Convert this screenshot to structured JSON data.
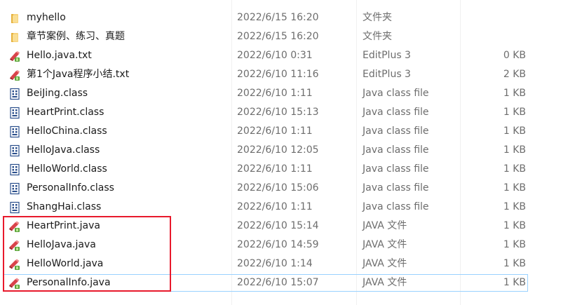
{
  "files": [
    {
      "name": "myhello",
      "date": "2022/6/15 16:20",
      "type": "文件夹",
      "size": "",
      "icon": "folder-icon"
    },
    {
      "name": "章节案例、练习、真题",
      "date": "2022/6/15 16:20",
      "type": "文件夹",
      "size": "",
      "icon": "folder-icon"
    },
    {
      "name": "Hello.java.txt",
      "date": "2022/6/10 0:31",
      "type": "EditPlus 3",
      "size": "0 KB",
      "icon": "editplus-file-icon"
    },
    {
      "name": "第1个Java程序小结.txt",
      "date": "2022/6/10 11:16",
      "type": "EditPlus 3",
      "size": "2 KB",
      "icon": "editplus-file-icon"
    },
    {
      "name": "BeiJing.class",
      "date": "2022/6/10 1:11",
      "type": "Java class file",
      "size": "1 KB",
      "icon": "class-file-icon"
    },
    {
      "name": "HeartPrint.class",
      "date": "2022/6/10 15:13",
      "type": "Java class file",
      "size": "1 KB",
      "icon": "class-file-icon"
    },
    {
      "name": "HelloChina.class",
      "date": "2022/6/10 1:11",
      "type": "Java class file",
      "size": "1 KB",
      "icon": "class-file-icon"
    },
    {
      "name": "HelloJava.class",
      "date": "2022/6/10 12:05",
      "type": "Java class file",
      "size": "1 KB",
      "icon": "class-file-icon"
    },
    {
      "name": "HelloWorld.class",
      "date": "2022/6/10 1:11",
      "type": "Java class file",
      "size": "1 KB",
      "icon": "class-file-icon"
    },
    {
      "name": "PersonalInfo.class",
      "date": "2022/6/10 15:06",
      "type": "Java class file",
      "size": "1 KB",
      "icon": "class-file-icon"
    },
    {
      "name": "ShangHai.class",
      "date": "2022/6/10 1:11",
      "type": "Java class file",
      "size": "1 KB",
      "icon": "class-file-icon"
    },
    {
      "name": "HeartPrint.java",
      "date": "2022/6/10 15:14",
      "type": "JAVA 文件",
      "size": "1 KB",
      "icon": "java-file-icon"
    },
    {
      "name": "HelloJava.java",
      "date": "2022/6/10 14:59",
      "type": "JAVA 文件",
      "size": "1 KB",
      "icon": "java-file-icon"
    },
    {
      "name": "HelloWorld.java",
      "date": "2022/6/10 1:14",
      "type": "JAVA 文件",
      "size": "1 KB",
      "icon": "java-file-icon"
    },
    {
      "name": "PersonalInfo.java",
      "date": "2022/6/10 15:07",
      "type": "JAVA 文件",
      "size": "1 KB",
      "icon": "java-file-icon",
      "selected": true
    }
  ],
  "colors": {
    "highlight_border": "#e8192c",
    "selection_border": "#99d1ff",
    "folder": "#f2c14e",
    "class_icon": "#2b4f8c",
    "java_icon": "#c8343a"
  }
}
